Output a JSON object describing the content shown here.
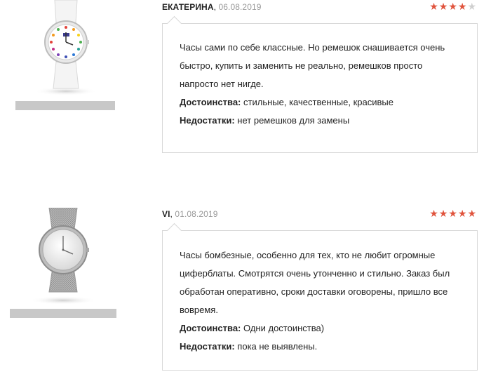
{
  "reviews": [
    {
      "author": "ЕКАТЕРИНА",
      "date": "06.08.2019",
      "rating": 4,
      "stars": {
        "filled": "★★★★",
        "empty": "★"
      },
      "text": "Часы сами по себе классные. Но ремешок снашивается очень быстро, купить и заменить не реально, ремешков просто напросто нет нигде.",
      "pros_label": "Достоинства:",
      "pros": "стильные, качественные, красивые",
      "cons_label": "Недостатки:",
      "cons": "нет ремешков для замены"
    },
    {
      "author": "VI",
      "date": "01.08.2019",
      "rating": 5,
      "stars": {
        "filled": "★★★★★",
        "empty": ""
      },
      "text": "Часы бомбезные, особенно для тех, кто не любит огромные циферблаты. Смотрятся очень утонченно и стильно. Заказ был обработан оперативно, сроки доставки оговорены, пришло все вовремя.",
      "pros_label": "Достоинства:",
      "pros": "Одни достоинства)",
      "cons_label": "Недостатки:",
      "cons": "пока не выявлены."
    }
  ],
  "colors": {
    "star": "#e0533c",
    "border": "#d8d8d8",
    "date": "#9a9a9a"
  },
  "icons": [
    "white-strap-watch-image",
    "mesh-bracelet-watch-image"
  ]
}
